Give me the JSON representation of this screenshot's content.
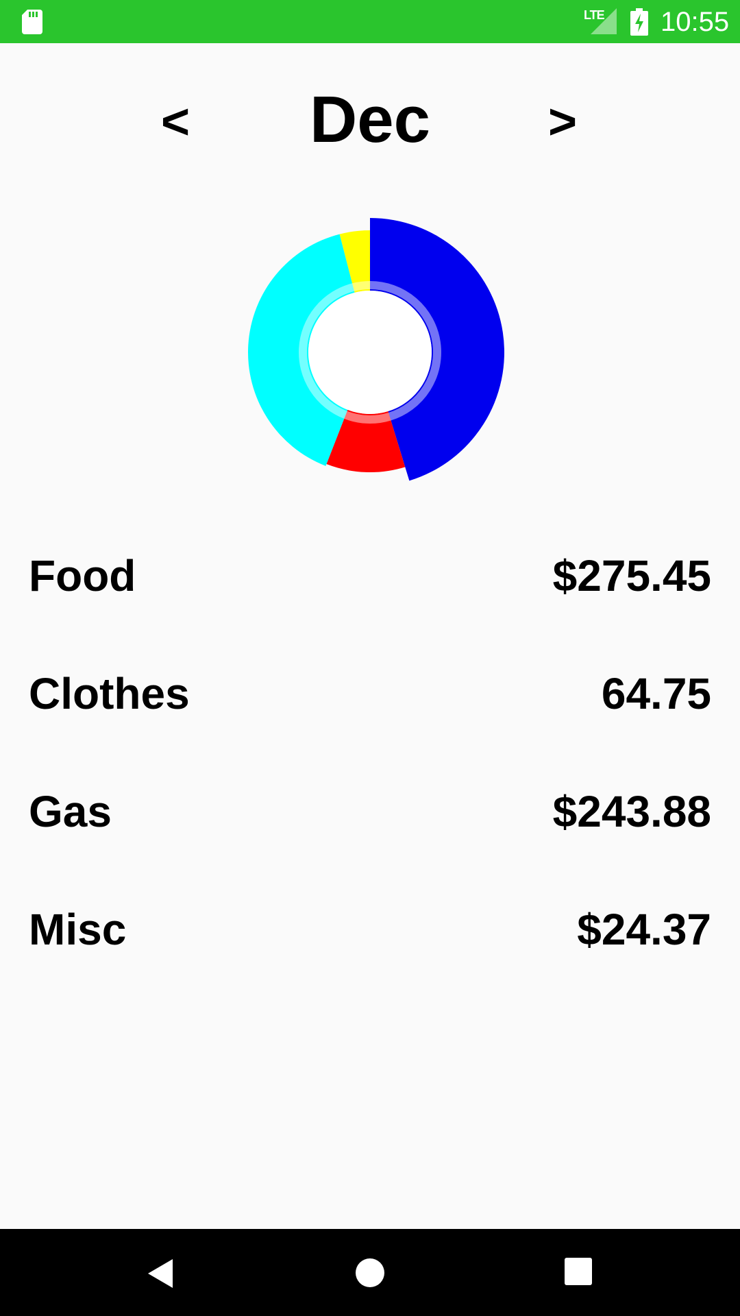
{
  "status_bar": {
    "network_label": "LTE",
    "time": "10:55",
    "icons": [
      "sd-card-icon",
      "signal-icon",
      "battery-charging-icon"
    ],
    "background_color": "#2ac52d"
  },
  "header": {
    "prev_label": "<",
    "month": "Dec",
    "next_label": ">"
  },
  "chart_data": {
    "type": "pie",
    "categories": [
      "Food",
      "Clothes",
      "Gas",
      "Misc"
    ],
    "values": [
      275.45,
      64.75,
      243.88,
      24.37
    ],
    "colors": [
      "#0000ee",
      "#ff0000",
      "#00ffff",
      "#ffff00"
    ],
    "style": "donut"
  },
  "categories": [
    {
      "label": "Food",
      "amount": "$275.45"
    },
    {
      "label": "Clothes",
      "amount": "64.75"
    },
    {
      "label": "Gas",
      "amount": "$243.88"
    },
    {
      "label": "Misc",
      "amount": "$24.37"
    }
  ],
  "nav_bar": {
    "icons": [
      "back-icon",
      "home-icon",
      "recents-icon"
    ]
  }
}
